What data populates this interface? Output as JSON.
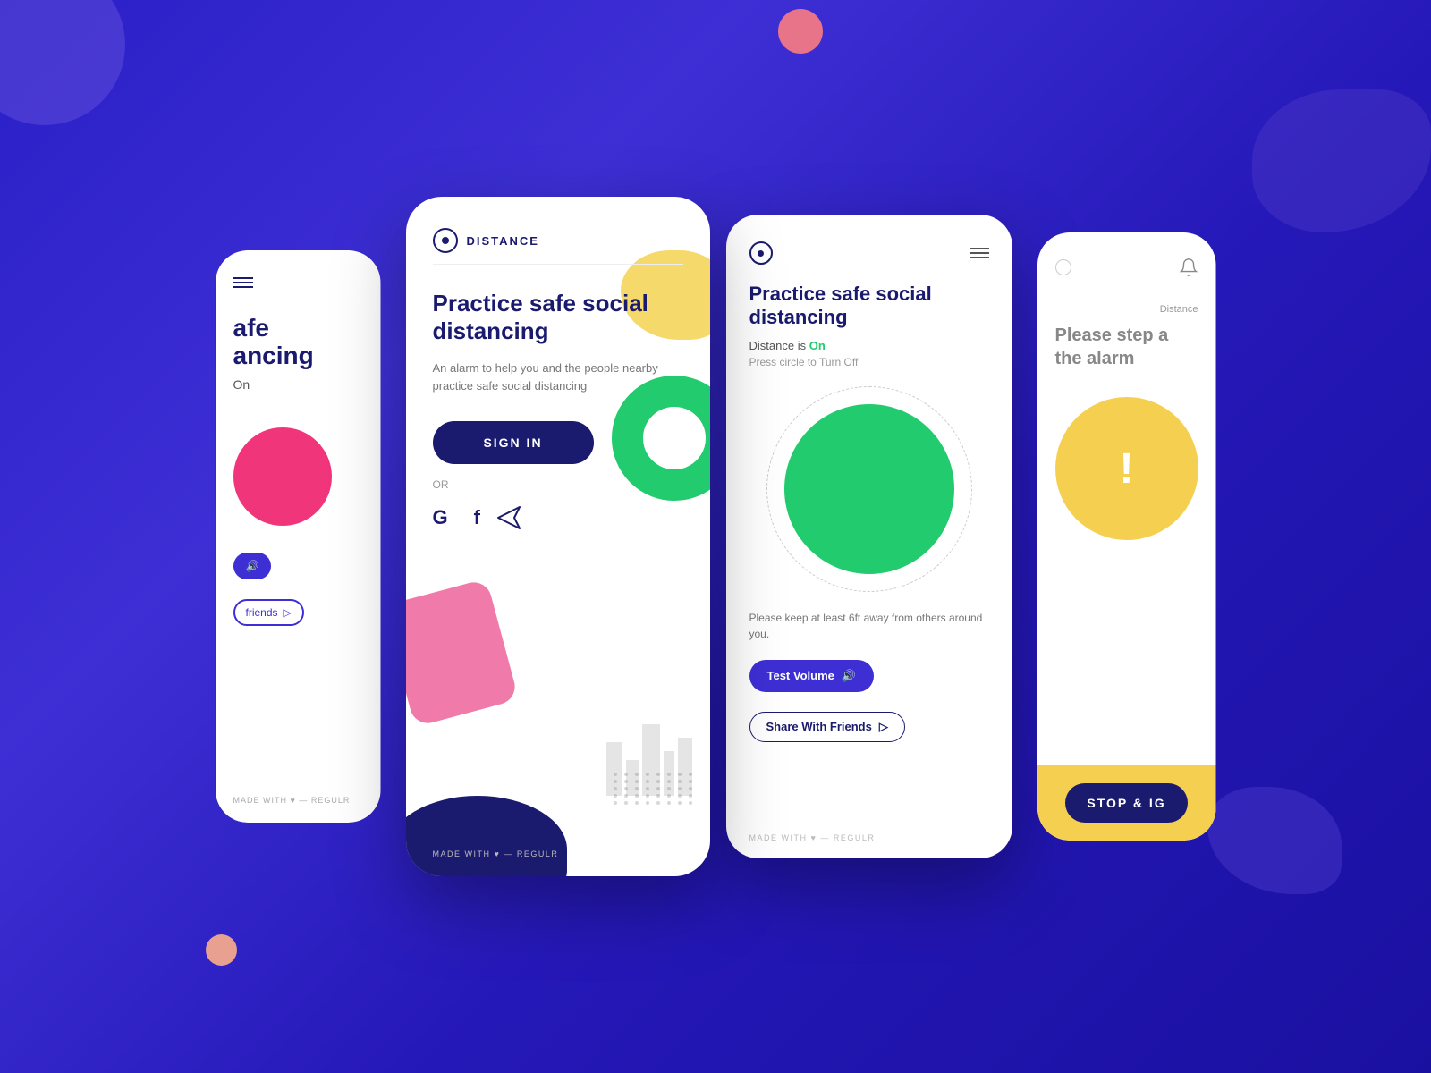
{
  "background": {
    "color": "#2a1fc7"
  },
  "phone1": {
    "menu_icon": "≡",
    "title_line1": "afe",
    "title_line2": "ancing",
    "on_label": "On",
    "volume_label": "♪",
    "friends_label": "friends",
    "footer": "MADE WITH ♥ — REGULR"
  },
  "phone2": {
    "logo_text": "DISTANCE",
    "title": "Practice safe social distancing",
    "subtitle": "An alarm to help you and the people nearby practice safe social distancing",
    "signin_label": "SIGN IN",
    "or_label": "OR",
    "google_label": "G",
    "facebook_label": "f",
    "footer": "MADE WITH ♥ — REGULR"
  },
  "phone3": {
    "title": "Practice safe social distancing",
    "status_prefix": "Distance is ",
    "status_on": "On",
    "press_text": "Press circle to Turn Off",
    "keep_text": "Please keep at least 6ft away from others around you.",
    "test_volume_label": "Test Volume",
    "share_label": "Share With Friends",
    "footer": "MADE WITH ♥ — REGULR"
  },
  "phone4": {
    "distance_label": "Distance",
    "title_line1": "Please step a",
    "title_line2": "the alarm",
    "exclaim": "!",
    "stop_label": "STOP & IG"
  }
}
